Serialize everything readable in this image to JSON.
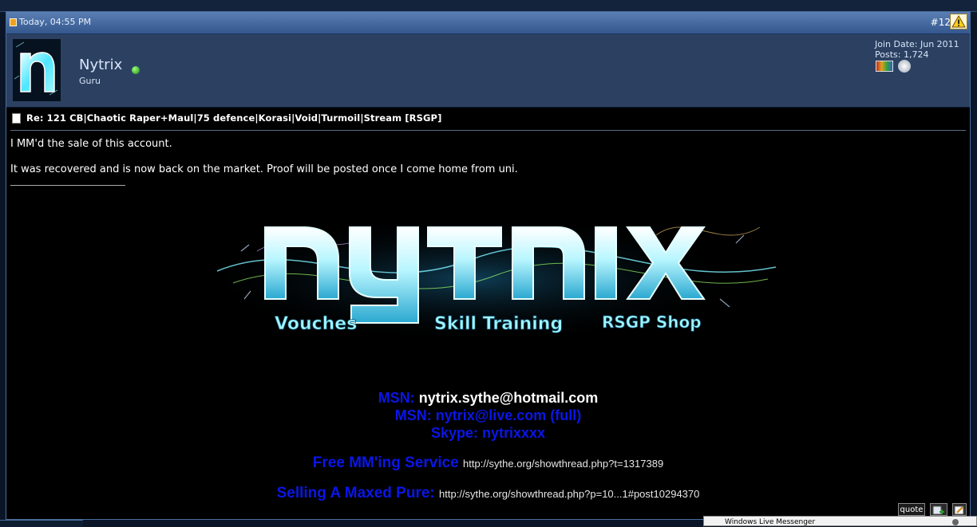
{
  "post": {
    "date": "Today, 04:55 PM",
    "number": "#12",
    "report_icon": "warning-icon"
  },
  "user": {
    "name": "Nytrix",
    "title": "Guru",
    "avatar_letter": "n",
    "online": true,
    "join_date": "Join Date: Jun 2011",
    "posts": "Posts: 1,724"
  },
  "content": {
    "title": "Re: 121 CB|Chaotic Raper+Maul|75 defence|Korasi|Void|Turmoil|Stream [RSGP]",
    "line1": "I MM'd the sale of this account.",
    "line2": "It was recovered and is now back on the market. Proof will be posted once I come home from uni."
  },
  "signature": {
    "banner": {
      "logo": "nytrix",
      "captions": [
        "Vouches",
        "Skill Training",
        "RSGP Shop"
      ]
    },
    "msn1_label": "MSN:",
    "msn1_value": "nytrix.sythe@hotmail.com",
    "msn2": "MSN: nytrix@live.com (full)",
    "skype": "Skype: nytrixxxx",
    "free_mm_label": "Free MM'ing Service",
    "free_mm_link": "http://sythe.org/showthread.php?t=1317389",
    "selling_label": "Selling A Maxed Pure:",
    "selling_link": "http://sythe.org/showthread.php?p=10...1#post10294370"
  },
  "actions": {
    "quote_label": "quote"
  },
  "popup": {
    "text": "Windows Live Messenger"
  },
  "colors": {
    "header_blue": "#34578d",
    "userbar": "#2c4162",
    "sig_blue": "#0a16e8",
    "banner_cyan": "#4fe6ff"
  }
}
